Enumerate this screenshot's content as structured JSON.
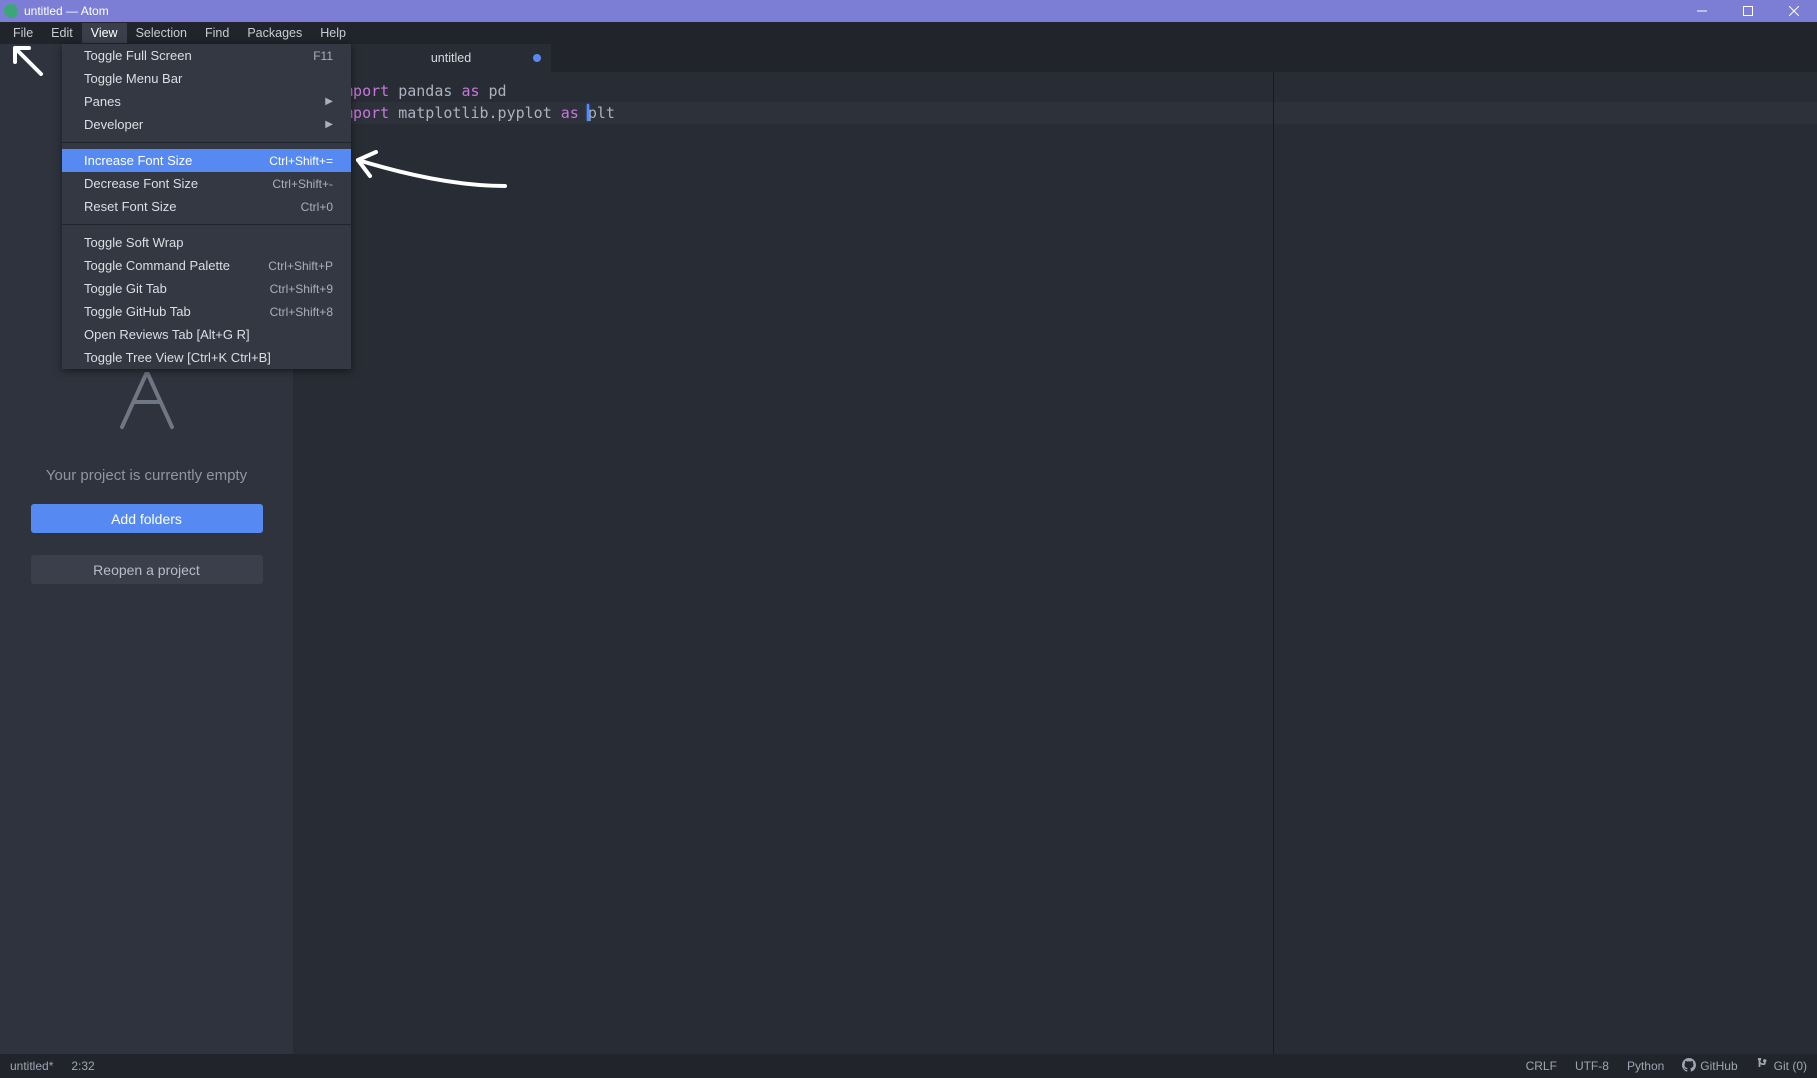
{
  "titlebar": {
    "title": "untitled — Atom"
  },
  "menubar": {
    "items": [
      "File",
      "Edit",
      "View",
      "Selection",
      "Find",
      "Packages",
      "Help"
    ],
    "active_index": 2
  },
  "view_menu": {
    "groups": [
      [
        {
          "label": "Toggle Full Screen",
          "shortcut": "F11"
        },
        {
          "label": "Toggle Menu Bar",
          "shortcut": ""
        },
        {
          "label": "Panes",
          "shortcut": "",
          "submenu": true
        },
        {
          "label": "Developer",
          "shortcut": "",
          "submenu": true
        }
      ],
      [
        {
          "label": "Increase Font Size",
          "shortcut": "Ctrl+Shift+=",
          "highlight": true
        },
        {
          "label": "Decrease Font Size",
          "shortcut": "Ctrl+Shift+-"
        },
        {
          "label": "Reset Font Size",
          "shortcut": "Ctrl+0"
        }
      ],
      [
        {
          "label": "Toggle Soft Wrap",
          "shortcut": ""
        },
        {
          "label": "Toggle Command Palette",
          "shortcut": "Ctrl+Shift+P"
        },
        {
          "label": "Toggle Git Tab",
          "shortcut": "Ctrl+Shift+9"
        },
        {
          "label": "Toggle GitHub Tab",
          "shortcut": "Ctrl+Shift+8"
        },
        {
          "label": "Open Reviews Tab [Alt+G R]",
          "shortcut": ""
        },
        {
          "label": "Toggle Tree View [Ctrl+K Ctrl+B]",
          "shortcut": ""
        }
      ]
    ]
  },
  "sidebar": {
    "empty_msg": "Your project is currently empty",
    "add_folders": "Add folders",
    "reopen": "Reopen a project"
  },
  "tab": {
    "label": "untitled",
    "modified": true
  },
  "editor": {
    "lines": [
      {
        "kw": "import ",
        "rest": "pandas ",
        "kw2": "as ",
        "rest2": "pd"
      },
      {
        "kw": "import ",
        "rest": "matplotlib.pyplot ",
        "kw2": "as ",
        "rest2": "plt"
      }
    ],
    "active_line": 1
  },
  "status": {
    "file": "untitled*",
    "pos": "2:32",
    "eol": "CRLF",
    "encoding": "UTF-8",
    "lang": "Python",
    "github": "GitHub",
    "git": "Git (0)"
  }
}
